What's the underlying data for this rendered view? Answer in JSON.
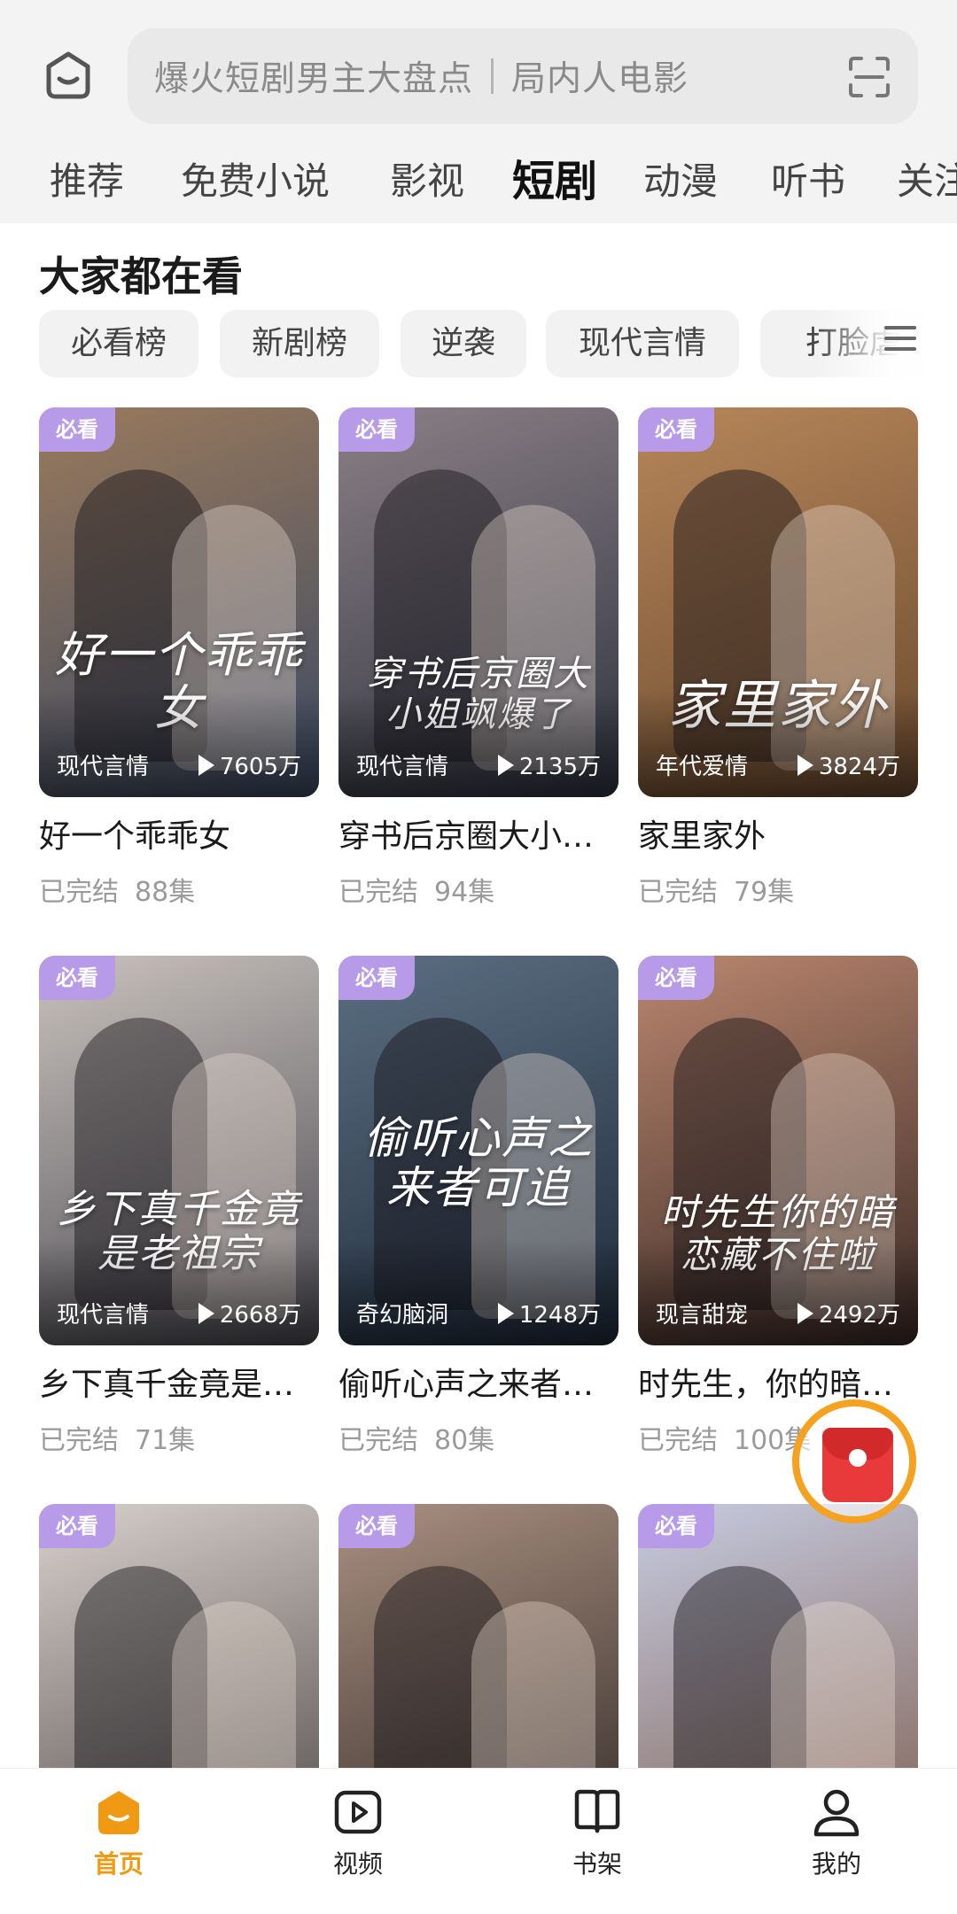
{
  "search": {
    "hint_left": "爆火短剧男主大盘点",
    "hint_right": "局内人电影"
  },
  "tabs": [
    {
      "label": "推荐"
    },
    {
      "label": "免费小说"
    },
    {
      "label": "影视"
    },
    {
      "label": "短剧",
      "active": true
    },
    {
      "label": "动漫"
    },
    {
      "label": "听书"
    },
    {
      "label": "关注"
    }
  ],
  "section": {
    "title": "大家都在看",
    "chips": [
      "必看榜",
      "新剧榜",
      "逆袭",
      "现代言情",
      "打脸虐"
    ]
  },
  "cards": [
    {
      "badge": "必看",
      "genre": "现代言情",
      "plays": "7605万",
      "art": "好一个乖乖女",
      "title": "好一个乖乖女",
      "status": "已完结",
      "episodes": "88集",
      "c1": "#3b4a63",
      "c2": "#9a7a5d"
    },
    {
      "badge": "必看",
      "genre": "现代言情",
      "plays": "2135万",
      "art": "穿书后京圈大小姐飒爆了",
      "title": "穿书后京圈大小…",
      "status": "已完结",
      "episodes": "94集",
      "c1": "#2f3440",
      "c2": "#8b7f86"
    },
    {
      "badge": "必看",
      "genre": "年代爱情",
      "plays": "3824万",
      "art": "家里家外",
      "title": "家里家外",
      "status": "已完结",
      "episodes": "79集",
      "c1": "#6a4a2e",
      "c2": "#b7865a"
    },
    {
      "badge": "必看",
      "genre": "现代言情",
      "plays": "2668万",
      "art": "乡下真千金竟是老祖宗",
      "title": "乡下真千金竟是…",
      "status": "已完结",
      "episodes": "71集",
      "c1": "#4b4a52",
      "c2": "#c9c2bd"
    },
    {
      "badge": "必看",
      "genre": "奇幻脑洞",
      "plays": "1248万",
      "art": "偷听心声之来者可追",
      "title": "偷听心声之来者…",
      "status": "已完结",
      "episodes": "80集",
      "c1": "#1f2a3a",
      "c2": "#5b6f82"
    },
    {
      "badge": "必看",
      "genre": "现言甜宠",
      "plays": "2492万",
      "art": "时先生你的暗恋藏不住啦",
      "title": "时先生，你的暗…",
      "status": "已完结",
      "episodes": "100集",
      "c1": "#3a2a26",
      "c2": "#b9866e"
    },
    {
      "badge": "必看",
      "genre": "",
      "plays": "",
      "art": "",
      "title": "",
      "status": "",
      "episodes": "",
      "c1": "#4a4444",
      "c2": "#d7d0cb"
    },
    {
      "badge": "必看",
      "genre": "",
      "plays": "",
      "art": "",
      "title": "",
      "status": "",
      "episodes": "",
      "c1": "#2c2624",
      "c2": "#a98f80"
    },
    {
      "badge": "必看",
      "genre": "",
      "plays": "",
      "art": "",
      "title": "",
      "status": "",
      "episodes": "",
      "c1": "#7a5a4a",
      "c2": "#c6cbe0"
    }
  ],
  "bottom_nav": [
    {
      "label": "首页",
      "icon": "home-icon",
      "active": true
    },
    {
      "label": "视频",
      "icon": "video-icon"
    },
    {
      "label": "书架",
      "icon": "bookshelf-icon"
    },
    {
      "label": "我的",
      "icon": "profile-icon"
    }
  ],
  "colors": {
    "accent": "#ef9a12",
    "badge": "#b79be8",
    "red_packet": "#e83a3a",
    "red_packet_ring": "#f4a21f"
  }
}
